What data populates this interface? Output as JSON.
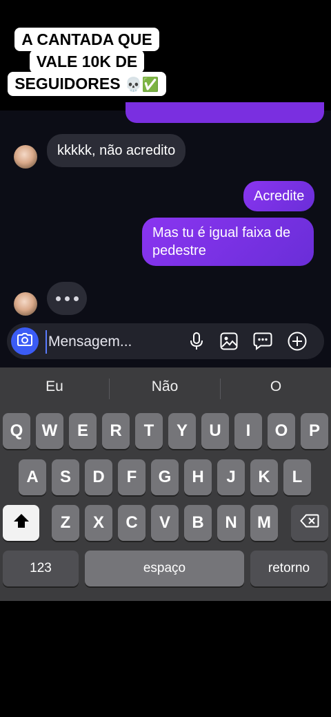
{
  "caption": {
    "line1": "A CANTADA QUE",
    "line2": "VALE 10K DE",
    "line3": "SEGUIDORES",
    "emojis": "💀✅"
  },
  "chat": {
    "messages": [
      {
        "side": "in",
        "text": "kkkkk, não acredito"
      },
      {
        "side": "out",
        "text": "Acredite"
      },
      {
        "side": "out",
        "text": "Mas tu é igual faixa de pedestre"
      }
    ]
  },
  "composer": {
    "placeholder": "Mensagem...",
    "icons": [
      "camera-icon",
      "microphone-icon",
      "gallery-icon",
      "sticker-icon",
      "plus-icon"
    ],
    "accent": "#3b5cf5"
  },
  "keyboard": {
    "suggestions": [
      "Eu",
      "Não",
      "O"
    ],
    "row1": [
      "Q",
      "W",
      "E",
      "R",
      "T",
      "Y",
      "U",
      "I",
      "O",
      "P"
    ],
    "row2": [
      "A",
      "S",
      "D",
      "F",
      "G",
      "H",
      "J",
      "K",
      "L"
    ],
    "row3": [
      "Z",
      "X",
      "C",
      "V",
      "B",
      "N",
      "M"
    ],
    "numbers_label": "123",
    "space_label": "espaço",
    "return_label": "retorno"
  },
  "colors": {
    "outgoing_bubble": "#7a2fe0",
    "incoming_bubble": "#2b2c36"
  }
}
